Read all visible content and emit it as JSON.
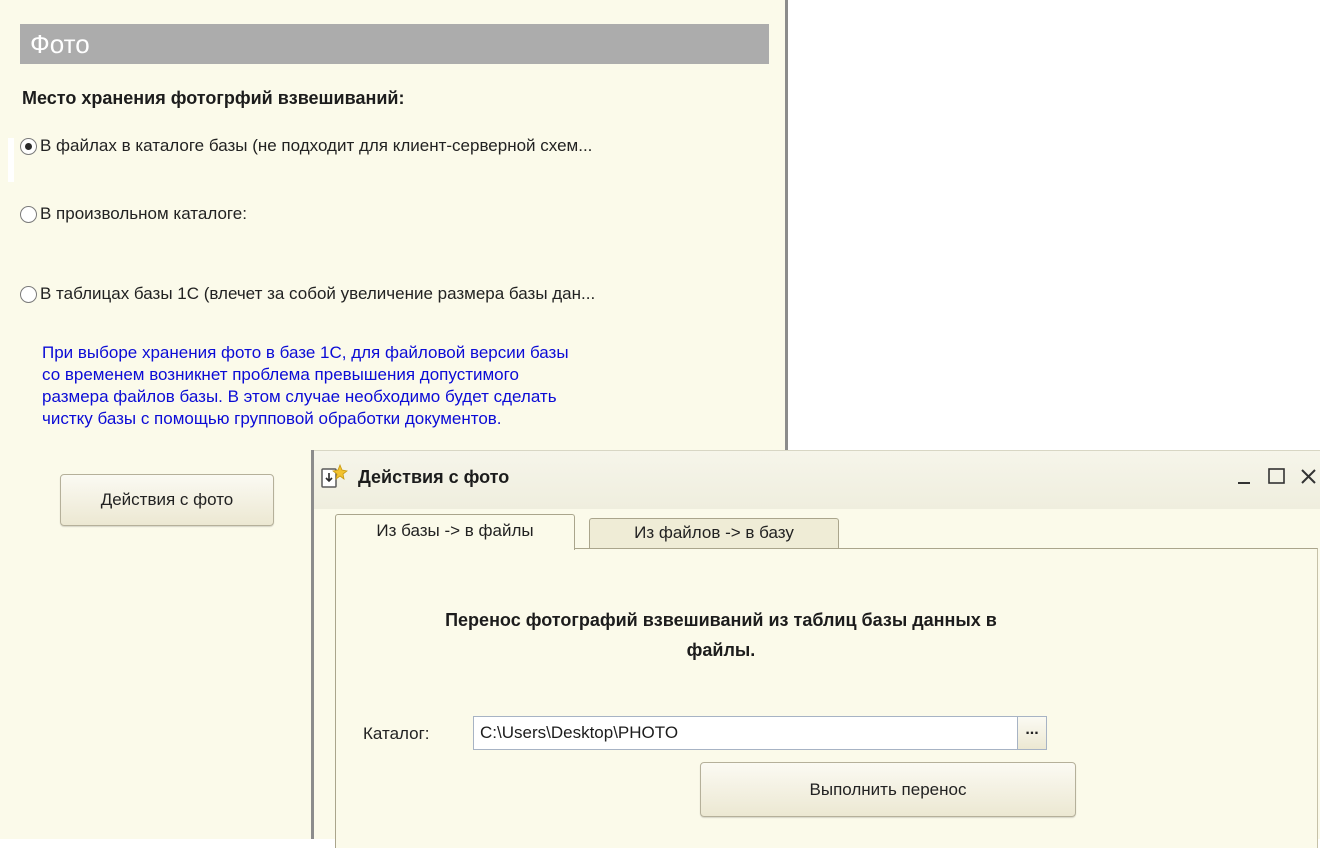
{
  "settings_panel": {
    "section_title": "Фото",
    "storage_group_label": "Место хранения фотогрфий взвешиваний:",
    "storage_options": [
      {
        "label": "В файлах в каталоге базы (не подходит для клиент-серверной схем...",
        "selected": true
      },
      {
        "label": "В произвольном каталоге:",
        "selected": false
      },
      {
        "label": "В таблицах базы 1С (влечет за собой увеличение размера базы дан...",
        "selected": false
      }
    ],
    "info_note_lines": [
      "При выборе хранения фото в базе 1С, для файловой версии базы",
      "со временем возникнет проблема превышения допустимого",
      "размера файлов базы. В этом случае необходимо будет сделать",
      "чистку базы с помощью групповой обработки документов."
    ],
    "actions_button_label": "Действия с фото"
  },
  "dialog": {
    "title": "Действия с фото",
    "window_buttons": [
      "minimize-icon",
      "maximize-icon",
      "close-icon"
    ],
    "tabs": [
      {
        "label": "Из базы -> в файлы",
        "active": true
      },
      {
        "label": "Из файлов -> в базу",
        "active": false
      }
    ],
    "transfer_title_lines": [
      "Перенос фотографий взвешиваний из таблиц базы данных в",
      "файлы."
    ],
    "catalog_label": "Каталог:",
    "catalog_value": "C:\\Users\\Desktop\\PHOTO",
    "browse_button_label": "...",
    "run_button_label": "Выполнить перенос"
  },
  "colors": {
    "panel_background": "#fbfaea",
    "section_header": "#acacac",
    "info_text": "#0b0bd6"
  }
}
